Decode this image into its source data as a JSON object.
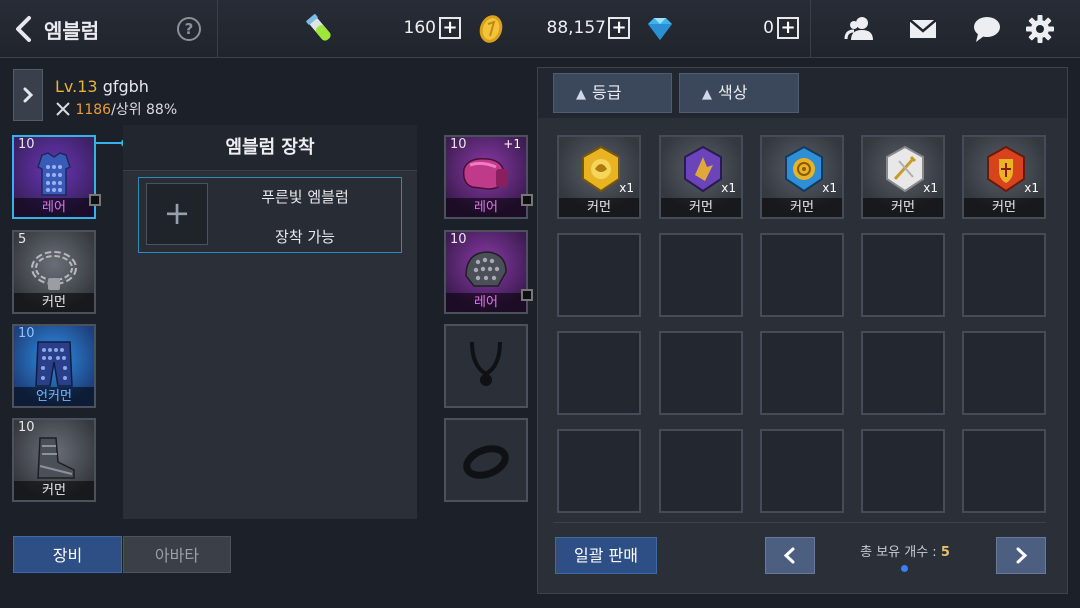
{
  "header": {
    "title": "엠블럼",
    "help_label": "?",
    "currencies": [
      {
        "icon": "energy-potion-icon",
        "value": "160"
      },
      {
        "icon": "gold-coin-icon",
        "value": "88,157"
      },
      {
        "icon": "diamond-icon",
        "value": "0"
      }
    ],
    "plus_label": "+",
    "icons": [
      "friends-icon",
      "mail-icon",
      "chat-icon",
      "settings-gear-icon"
    ]
  },
  "character": {
    "level": "Lv.13",
    "name": "gfgbh",
    "power": "1186",
    "rank": "/상위 88%"
  },
  "left_slots": [
    {
      "level": "10",
      "rarity": "레어",
      "item": "chest-armor-icon"
    },
    {
      "level": "5",
      "rarity": "커먼",
      "item": "chain-necklace-icon"
    },
    {
      "level": "10",
      "rarity": "언커먼",
      "item": "leg-armor-icon"
    },
    {
      "level": "10",
      "rarity": "커먼",
      "item": "boots-icon"
    }
  ],
  "right_slots": [
    {
      "level": "10",
      "upgrade": "+1",
      "rarity": "레어",
      "item": "glove-icon"
    },
    {
      "level": "10",
      "rarity": "레어",
      "item": "helmet-icon"
    },
    {
      "item": "necklace-empty-icon"
    },
    {
      "item": "ring-empty-icon"
    }
  ],
  "emblem_panel": {
    "title": "엠블럼 장착",
    "plus": "+",
    "slot_name": "푸른빛 엠블럼",
    "slot_status": "장착 가능"
  },
  "tabs": {
    "equip": "장비",
    "avatar": "아바타"
  },
  "inventory": {
    "sort_grade": "등급",
    "sort_color": "색상",
    "sort_arrow": "▲",
    "items": [
      {
        "icon": "gold-emblem-icon",
        "count": "x1",
        "rarity": "커먼",
        "color": "#e8b424"
      },
      {
        "icon": "purple-emblem-icon",
        "count": "x1",
        "rarity": "커먼",
        "color": "#7a4ec9"
      },
      {
        "icon": "blue-emblem-icon",
        "count": "x1",
        "rarity": "커먼",
        "color": "#2f8fd6"
      },
      {
        "icon": "white-emblem-icon",
        "count": "x1",
        "rarity": "커먼",
        "color": "#e8e8e8"
      },
      {
        "icon": "red-emblem-icon",
        "count": "x1",
        "rarity": "커먼",
        "color": "#d8431e"
      }
    ],
    "sell_all": "일괄 판매",
    "total_label": "총 보유 개수 :",
    "total_count": "5",
    "prev": "‹",
    "next": "›"
  }
}
